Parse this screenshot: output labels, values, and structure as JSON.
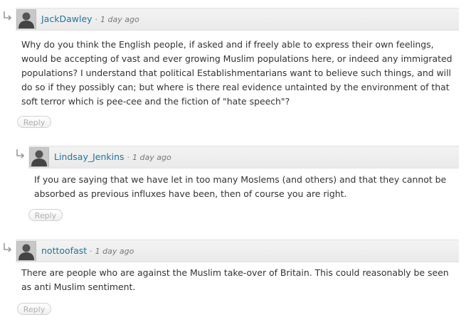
{
  "comments": [
    {
      "author": "JackDawley",
      "separator": "·",
      "time": "1 day ago",
      "text": "Why do you think the English people, if asked and if freely able to express their own feelings, would be accepting of vast and ever growing Muslim populations here, or indeed any immigrated populations? I understand that political Establishmentarians want to believe such things, and will do so if they possibly can; but where is there real evidence untainted by the environment of that soft terror which is pee-cee and the fiction of \"hate speech\"?",
      "reply_label": "Reply"
    },
    {
      "author": "Lindsay_Jenkins",
      "separator": "·",
      "time": "1 day ago",
      "text": "If you are saying that we have let in too many Moslems (and others) and that they cannot be absorbed as previous influxes have been, then of course you are right.",
      "reply_label": "Reply"
    },
    {
      "author": "nottoofast",
      "separator": "·",
      "time": "1 day ago",
      "text": "There are people who are against the Muslim take-over of Britain. This could reasonably be seen as anti Muslim sentiment.",
      "reply_label": "Reply"
    }
  ],
  "icons": {
    "reply_arrow": "reply-arrow-icon",
    "avatar": "default-avatar-silhouette"
  }
}
